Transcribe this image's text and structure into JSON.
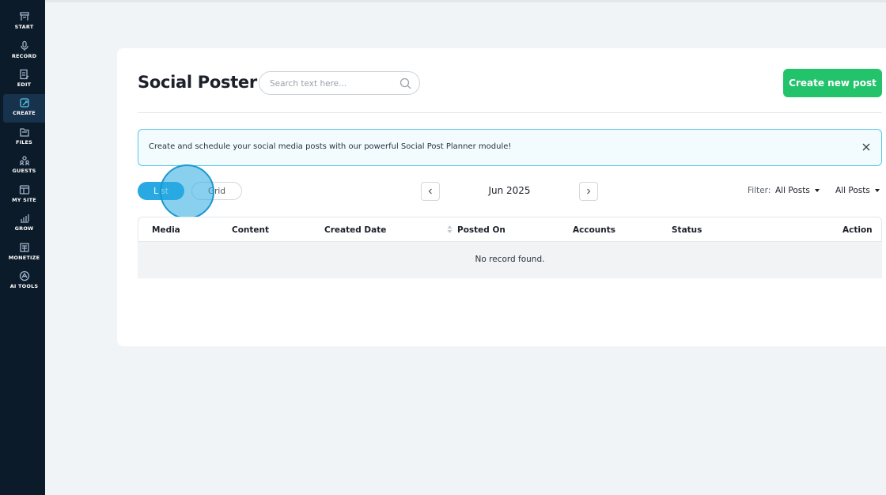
{
  "sidebar": {
    "items": [
      {
        "label": "START",
        "icon": "start-icon"
      },
      {
        "label": "RECORD",
        "icon": "microphone-icon"
      },
      {
        "label": "EDIT",
        "icon": "edit-icon"
      },
      {
        "label": "CREATE",
        "icon": "create-icon",
        "active": true
      },
      {
        "label": "FILES",
        "icon": "files-icon"
      },
      {
        "label": "GUESTS",
        "icon": "guests-icon"
      },
      {
        "label": "MY SITE",
        "icon": "site-icon"
      },
      {
        "label": "GROW",
        "icon": "grow-icon"
      },
      {
        "label": "MONETIZE",
        "icon": "monetize-icon"
      },
      {
        "label": "AI TOOLS",
        "icon": "ai-tools-icon"
      }
    ]
  },
  "header": {
    "title": "Social Poster",
    "search_placeholder": "Search text here...",
    "create_label": "Create new post"
  },
  "banner": {
    "text": "Create and schedule your social media posts with our powerful Social Post Planner module!"
  },
  "view_toggle": {
    "list_label": "L st",
    "grid_label": "Grid",
    "selected": "list"
  },
  "pager": {
    "month": "Jun 2025"
  },
  "filter": {
    "label": "Filter:",
    "first_value": "All Posts",
    "second_value": "All Posts"
  },
  "table": {
    "columns": [
      "Media",
      "Content",
      "Created Date",
      "Posted On",
      "Accounts",
      "Status",
      "Action"
    ],
    "empty_message": "No record found."
  },
  "colors": {
    "sidebar_bg": "#0c1b2a",
    "accent_blue": "#28a9e1",
    "primary_green": "#22c36b",
    "banner_border": "#5cc7e8"
  }
}
